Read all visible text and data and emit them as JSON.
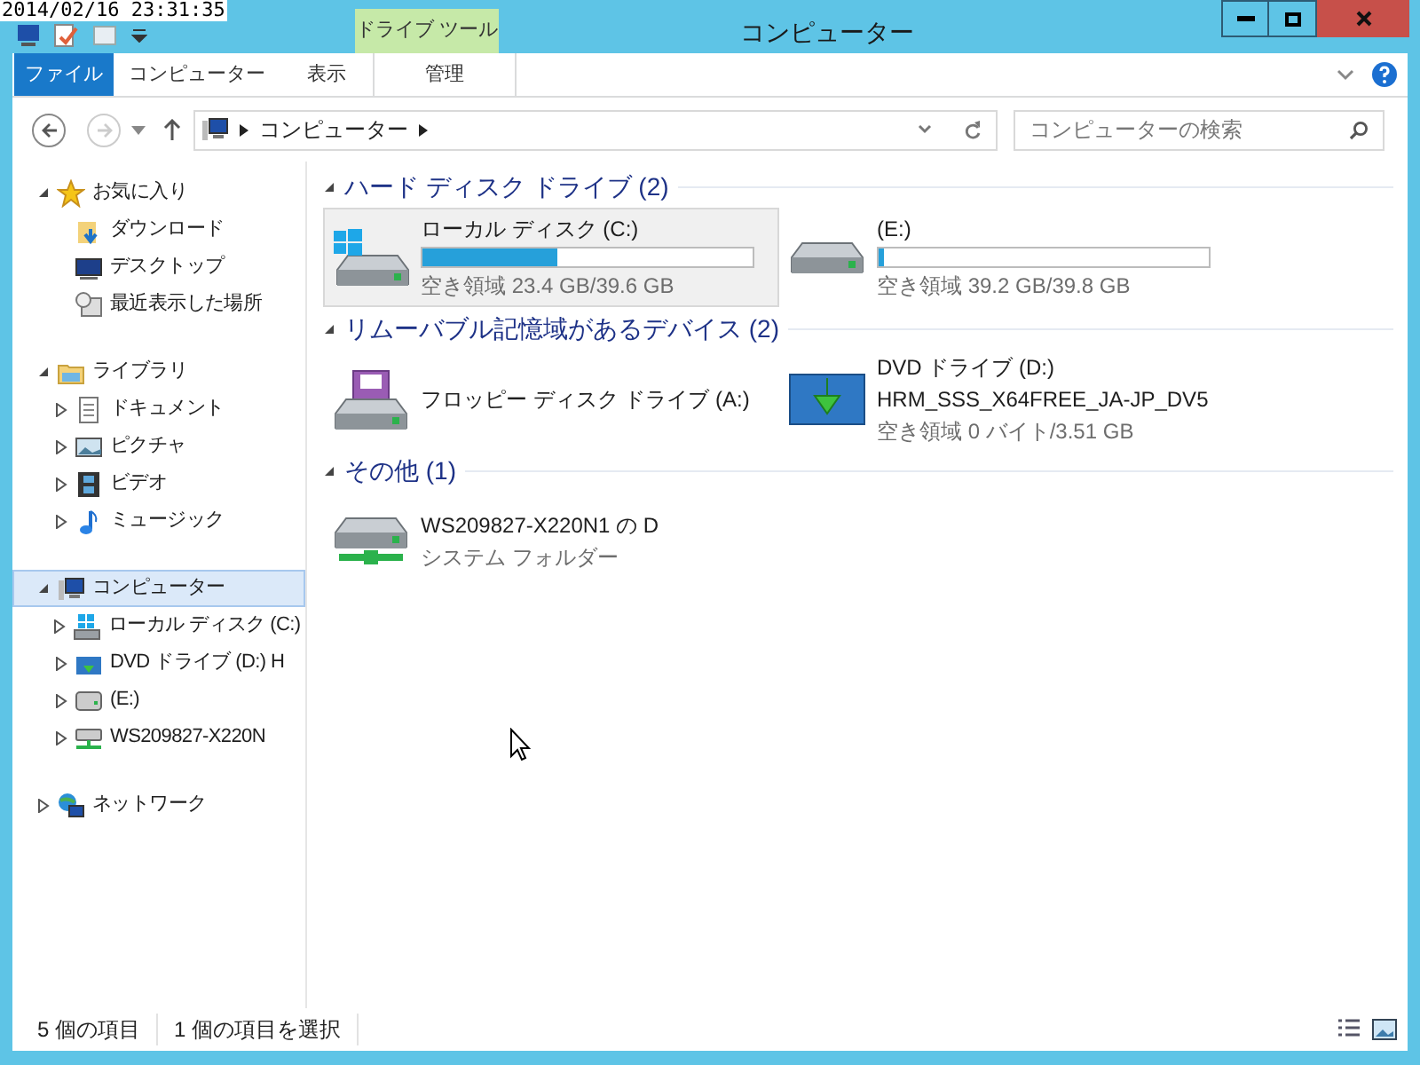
{
  "timestamp": "2014/02/16 23:31:35",
  "window": {
    "title": "コンピューター",
    "context_tab_group": "ドライブ ツール"
  },
  "ribbon_tabs": [
    {
      "label": "ファイル",
      "kind": "file",
      "selected": false
    },
    {
      "label": "コンピューター",
      "kind": "tab",
      "selected": false
    },
    {
      "label": "表示",
      "kind": "tab",
      "selected": false
    },
    {
      "label": "管理",
      "kind": "context",
      "selected": false
    }
  ],
  "address": {
    "path": [
      "コンピューター"
    ],
    "forward_disabled": true
  },
  "search": {
    "placeholder": "コンピューターの検索"
  },
  "tree": [
    {
      "label": "お気に入り",
      "expanded": true,
      "selected": false,
      "kind": "star",
      "children": [
        {
          "label": "ダウンロード",
          "selected": false,
          "kind": "download"
        },
        {
          "label": "デスクトップ",
          "selected": false,
          "kind": "desktop"
        },
        {
          "label": "最近表示した場所",
          "selected": false,
          "kind": "recent"
        }
      ]
    },
    {
      "label": "ライブラリ",
      "expanded": true,
      "selected": false,
      "kind": "library",
      "children": [
        {
          "label": "ドキュメント",
          "expanded": false,
          "selected": false,
          "kind": "document"
        },
        {
          "label": "ピクチャ",
          "expanded": false,
          "selected": false,
          "kind": "picture"
        },
        {
          "label": "ビデオ",
          "expanded": false,
          "selected": false,
          "kind": "video"
        },
        {
          "label": "ミュージック",
          "expanded": false,
          "selected": false,
          "kind": "music"
        }
      ]
    },
    {
      "label": "コンピューター",
      "expanded": true,
      "selected": true,
      "kind": "computer",
      "children": [
        {
          "label": "ローカル ディスク (C:)",
          "expanded": false,
          "selected": false,
          "kind": "windisk"
        },
        {
          "label": "DVD ドライブ (D:) H",
          "expanded": false,
          "selected": false,
          "kind": "dvd"
        },
        {
          "label": "(E:)",
          "expanded": false,
          "selected": false,
          "kind": "disk"
        },
        {
          "label": "WS209827-X220N",
          "expanded": false,
          "selected": false,
          "kind": "netdrive"
        }
      ]
    },
    {
      "label": "ネットワーク",
      "expanded": false,
      "selected": false,
      "kind": "network"
    }
  ],
  "groups": [
    {
      "title": "ハード ディスク ドライブ (2)",
      "expanded": true,
      "items": [
        {
          "name": "ローカル ディスク (C:)",
          "kind": "windisk",
          "selected": true,
          "level": 0.41,
          "details": [
            "空き領域 23.4 GB/39.6 GB"
          ]
        },
        {
          "name": "(E:)",
          "kind": "disk",
          "selected": false,
          "level": 0.015,
          "details": [
            "空き領域 39.2 GB/39.8 GB"
          ]
        }
      ]
    },
    {
      "title": "リムーバブル記憶域があるデバイス (2)",
      "expanded": true,
      "items": [
        {
          "name": "フロッピー ディスク ドライブ (A:)",
          "kind": "floppy",
          "selected": false
        },
        {
          "name": "DVD ドライブ (D:)",
          "kind": "dvd",
          "selected": false,
          "details": [
            "HRM_SSS_X64FREE_JA-JP_DV5",
            "空き領域 0 バイト/3.51 GB"
          ]
        }
      ]
    },
    {
      "title": "その他 (1)",
      "expanded": true,
      "items": [
        {
          "name": "WS209827-X220N1 の D",
          "kind": "netdrive",
          "selected": false,
          "details": [
            "システム フォルダー"
          ]
        }
      ]
    }
  ],
  "status_bar": {
    "count": "5 個の項目",
    "selection": "1 個の項目を選択"
  }
}
